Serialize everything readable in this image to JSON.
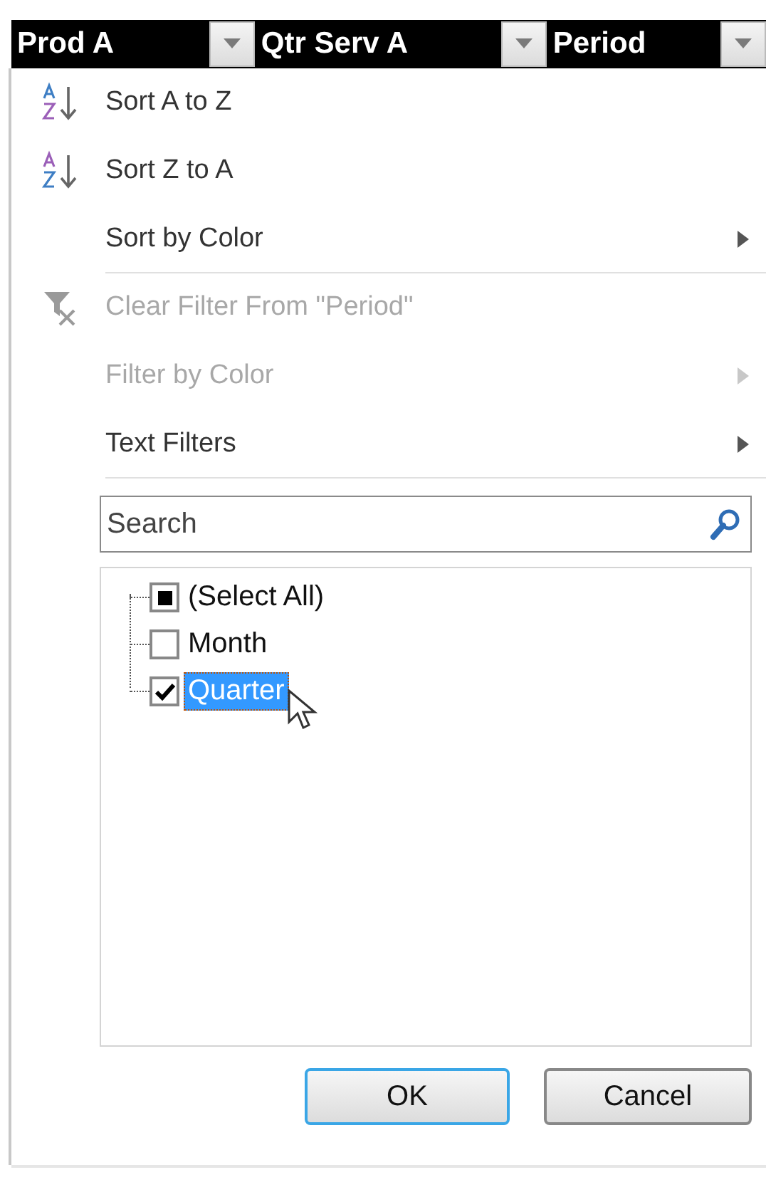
{
  "columns": [
    {
      "label": "Prod A"
    },
    {
      "label": "Qtr Serv A"
    },
    {
      "label": "Period"
    }
  ],
  "menu_items": [
    {
      "kind": "sort_az",
      "label": "Sort A to Z",
      "disabled": false,
      "submenu": false,
      "separator_after": false
    },
    {
      "kind": "sort_za",
      "label": "Sort Z to A",
      "disabled": false,
      "submenu": false,
      "separator_after": false
    },
    {
      "kind": "plain",
      "label": "Sort by Color",
      "disabled": false,
      "submenu": true,
      "separator_after": true
    },
    {
      "kind": "clear_filter",
      "label": "Clear Filter From \"Period\"",
      "disabled": true,
      "submenu": false,
      "separator_after": false
    },
    {
      "kind": "plain",
      "label": "Filter by Color",
      "disabled": true,
      "submenu": true,
      "separator_after": false
    },
    {
      "kind": "plain",
      "label": "Text Filters",
      "disabled": false,
      "submenu": true,
      "separator_after": true
    }
  ],
  "search": {
    "placeholder": "Search"
  },
  "values": [
    {
      "label": "(Select All)",
      "checked": false,
      "partial": true,
      "selected": false
    },
    {
      "label": "Month",
      "checked": false,
      "partial": false,
      "selected": false
    },
    {
      "label": "Quarter",
      "checked": true,
      "partial": false,
      "selected": true
    }
  ],
  "buttons": [
    {
      "label": "OK",
      "default": true
    },
    {
      "label": "Cancel",
      "default": false
    }
  ]
}
